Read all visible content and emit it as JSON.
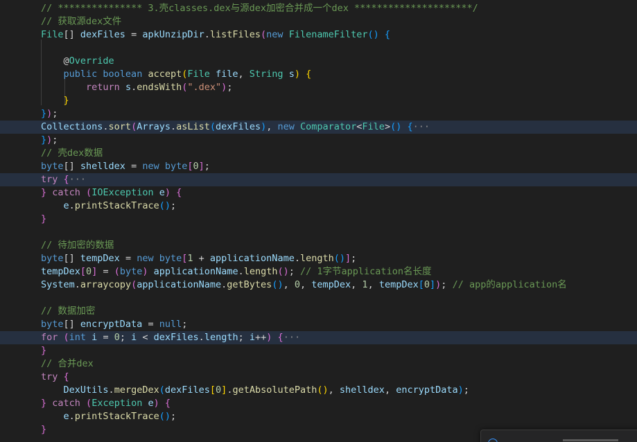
{
  "editor": {
    "lines": [
      {
        "highlight": false,
        "tokens": [
          {
            "t": "// *************** 3.壳classes.dex与源dex加密合并成一个dex *********************/",
            "c": "comment"
          }
        ]
      },
      {
        "highlight": false,
        "tokens": [
          {
            "t": "// 获取源dex文件",
            "c": "comment"
          }
        ]
      },
      {
        "highlight": false,
        "tokens": [
          {
            "t": "File",
            "c": "type"
          },
          {
            "t": "[] ",
            "c": "punc"
          },
          {
            "t": "dexFiles",
            "c": "var"
          },
          {
            "t": " = ",
            "c": "punc"
          },
          {
            "t": "apkUnzipDir",
            "c": "var"
          },
          {
            "t": ".",
            "c": "punc"
          },
          {
            "t": "listFiles",
            "c": "fn"
          },
          {
            "t": "(",
            "c": "b2"
          },
          {
            "t": "new ",
            "c": "kw"
          },
          {
            "t": "FilenameFilter",
            "c": "type"
          },
          {
            "t": "()",
            "c": "b3"
          },
          {
            "t": " ",
            "c": "punc"
          },
          {
            "t": "{",
            "c": "b3"
          }
        ]
      },
      {
        "highlight": false,
        "tokens": []
      },
      {
        "highlight": false,
        "tokens": [
          {
            "t": "    ",
            "c": "punc"
          },
          {
            "t": "@",
            "c": "punc"
          },
          {
            "t": "Override",
            "c": "type"
          }
        ]
      },
      {
        "highlight": false,
        "tokens": [
          {
            "t": "    ",
            "c": "punc"
          },
          {
            "t": "public ",
            "c": "kw"
          },
          {
            "t": "boolean ",
            "c": "kw"
          },
          {
            "t": "accept",
            "c": "fn"
          },
          {
            "t": "(",
            "c": "b1"
          },
          {
            "t": "File ",
            "c": "type"
          },
          {
            "t": "file",
            "c": "var"
          },
          {
            "t": ", ",
            "c": "punc"
          },
          {
            "t": "String ",
            "c": "type"
          },
          {
            "t": "s",
            "c": "var"
          },
          {
            "t": ")",
            "c": "b1"
          },
          {
            "t": " ",
            "c": "punc"
          },
          {
            "t": "{",
            "c": "b1"
          }
        ]
      },
      {
        "highlight": false,
        "tokens": [
          {
            "t": "        ",
            "c": "punc"
          },
          {
            "t": "return ",
            "c": "ctrl"
          },
          {
            "t": "s",
            "c": "var"
          },
          {
            "t": ".",
            "c": "punc"
          },
          {
            "t": "endsWith",
            "c": "fn"
          },
          {
            "t": "(",
            "c": "b2"
          },
          {
            "t": "\".dex\"",
            "c": "str"
          },
          {
            "t": ")",
            "c": "b2"
          },
          {
            "t": ";",
            "c": "punc"
          }
        ]
      },
      {
        "highlight": false,
        "tokens": [
          {
            "t": "    ",
            "c": "punc"
          },
          {
            "t": "}",
            "c": "b1"
          }
        ]
      },
      {
        "highlight": false,
        "tokens": [
          {
            "t": "}",
            "c": "b3"
          },
          {
            "t": ")",
            "c": "b2"
          },
          {
            "t": ";",
            "c": "punc"
          }
        ]
      },
      {
        "highlight": true,
        "tokens": [
          {
            "t": "Collections",
            "c": "var"
          },
          {
            "t": ".",
            "c": "punc"
          },
          {
            "t": "sort",
            "c": "fn"
          },
          {
            "t": "(",
            "c": "b2"
          },
          {
            "t": "Arrays",
            "c": "var"
          },
          {
            "t": ".",
            "c": "punc"
          },
          {
            "t": "asList",
            "c": "fn"
          },
          {
            "t": "(",
            "c": "b3"
          },
          {
            "t": "dexFiles",
            "c": "var"
          },
          {
            "t": ")",
            "c": "b3"
          },
          {
            "t": ", ",
            "c": "punc"
          },
          {
            "t": "new ",
            "c": "kw"
          },
          {
            "t": "Comparator",
            "c": "type"
          },
          {
            "t": "<",
            "c": "punc"
          },
          {
            "t": "File",
            "c": "type"
          },
          {
            "t": ">",
            "c": "punc"
          },
          {
            "t": "()",
            "c": "b3"
          },
          {
            "t": " ",
            "c": "punc"
          },
          {
            "t": "{",
            "c": "b3"
          },
          {
            "t": "···",
            "c": "fold"
          }
        ]
      },
      {
        "highlight": false,
        "tokens": [
          {
            "t": "}",
            "c": "b3"
          },
          {
            "t": ")",
            "c": "b2"
          },
          {
            "t": ";",
            "c": "punc"
          }
        ]
      },
      {
        "highlight": false,
        "tokens": [
          {
            "t": "// 壳dex数据",
            "c": "comment"
          }
        ]
      },
      {
        "highlight": false,
        "tokens": [
          {
            "t": "byte",
            "c": "kw"
          },
          {
            "t": "[] ",
            "c": "punc"
          },
          {
            "t": "shelldex",
            "c": "var"
          },
          {
            "t": " = ",
            "c": "punc"
          },
          {
            "t": "new ",
            "c": "kw"
          },
          {
            "t": "byte",
            "c": "kw"
          },
          {
            "t": "[",
            "c": "b2"
          },
          {
            "t": "0",
            "c": "num"
          },
          {
            "t": "]",
            "c": "b2"
          },
          {
            "t": ";",
            "c": "punc"
          }
        ]
      },
      {
        "highlight": true,
        "tokens": [
          {
            "t": "try ",
            "c": "ctrl"
          },
          {
            "t": "{",
            "c": "b2"
          },
          {
            "t": "···",
            "c": "fold"
          }
        ]
      },
      {
        "highlight": false,
        "tokens": [
          {
            "t": "} ",
            "c": "b2"
          },
          {
            "t": "catch ",
            "c": "ctrl"
          },
          {
            "t": "(",
            "c": "b2"
          },
          {
            "t": "IOException ",
            "c": "type"
          },
          {
            "t": "e",
            "c": "var"
          },
          {
            "t": ")",
            "c": "b2"
          },
          {
            "t": " ",
            "c": "punc"
          },
          {
            "t": "{",
            "c": "b2"
          }
        ]
      },
      {
        "highlight": false,
        "tokens": [
          {
            "t": "    ",
            "c": "punc"
          },
          {
            "t": "e",
            "c": "var"
          },
          {
            "t": ".",
            "c": "punc"
          },
          {
            "t": "printStackTrace",
            "c": "fn"
          },
          {
            "t": "()",
            "c": "b3"
          },
          {
            "t": ";",
            "c": "punc"
          }
        ]
      },
      {
        "highlight": false,
        "tokens": [
          {
            "t": "}",
            "c": "b2"
          }
        ]
      },
      {
        "highlight": false,
        "tokens": []
      },
      {
        "highlight": false,
        "tokens": [
          {
            "t": "// 待加密的数据",
            "c": "comment"
          }
        ]
      },
      {
        "highlight": false,
        "tokens": [
          {
            "t": "byte",
            "c": "kw"
          },
          {
            "t": "[] ",
            "c": "punc"
          },
          {
            "t": "tempDex",
            "c": "var"
          },
          {
            "t": " = ",
            "c": "punc"
          },
          {
            "t": "new ",
            "c": "kw"
          },
          {
            "t": "byte",
            "c": "kw"
          },
          {
            "t": "[",
            "c": "b2"
          },
          {
            "t": "1",
            "c": "num"
          },
          {
            "t": " + ",
            "c": "punc"
          },
          {
            "t": "applicationName",
            "c": "var"
          },
          {
            "t": ".",
            "c": "punc"
          },
          {
            "t": "length",
            "c": "fn"
          },
          {
            "t": "()",
            "c": "b3"
          },
          {
            "t": "]",
            "c": "b2"
          },
          {
            "t": ";",
            "c": "punc"
          }
        ]
      },
      {
        "highlight": false,
        "tokens": [
          {
            "t": "tempDex",
            "c": "var"
          },
          {
            "t": "[",
            "c": "b2"
          },
          {
            "t": "0",
            "c": "num"
          },
          {
            "t": "]",
            "c": "b2"
          },
          {
            "t": " = ",
            "c": "punc"
          },
          {
            "t": "(",
            "c": "b2"
          },
          {
            "t": "byte",
            "c": "kw"
          },
          {
            "t": ")",
            "c": "b2"
          },
          {
            "t": " ",
            "c": "punc"
          },
          {
            "t": "applicationName",
            "c": "var"
          },
          {
            "t": ".",
            "c": "punc"
          },
          {
            "t": "length",
            "c": "fn"
          },
          {
            "t": "()",
            "c": "b2"
          },
          {
            "t": "; ",
            "c": "punc"
          },
          {
            "t": "// 1字节application名长度",
            "c": "comment"
          }
        ]
      },
      {
        "highlight": false,
        "tokens": [
          {
            "t": "System",
            "c": "var"
          },
          {
            "t": ".",
            "c": "punc"
          },
          {
            "t": "arraycopy",
            "c": "fn"
          },
          {
            "t": "(",
            "c": "b2"
          },
          {
            "t": "applicationName",
            "c": "var"
          },
          {
            "t": ".",
            "c": "punc"
          },
          {
            "t": "getBytes",
            "c": "fn"
          },
          {
            "t": "()",
            "c": "b3"
          },
          {
            "t": ", ",
            "c": "punc"
          },
          {
            "t": "0",
            "c": "num"
          },
          {
            "t": ", ",
            "c": "punc"
          },
          {
            "t": "tempDex",
            "c": "var"
          },
          {
            "t": ", ",
            "c": "punc"
          },
          {
            "t": "1",
            "c": "num"
          },
          {
            "t": ", ",
            "c": "punc"
          },
          {
            "t": "tempDex",
            "c": "var"
          },
          {
            "t": "[",
            "c": "b3"
          },
          {
            "t": "0",
            "c": "num"
          },
          {
            "t": "]",
            "c": "b3"
          },
          {
            "t": ")",
            "c": "b2"
          },
          {
            "t": "; ",
            "c": "punc"
          },
          {
            "t": "// app的application名",
            "c": "comment"
          }
        ]
      },
      {
        "highlight": false,
        "tokens": []
      },
      {
        "highlight": false,
        "tokens": [
          {
            "t": "// 数据加密",
            "c": "comment"
          }
        ]
      },
      {
        "highlight": false,
        "tokens": [
          {
            "t": "byte",
            "c": "kw"
          },
          {
            "t": "[] ",
            "c": "punc"
          },
          {
            "t": "encryptData",
            "c": "var"
          },
          {
            "t": " = ",
            "c": "punc"
          },
          {
            "t": "null",
            "c": "kw"
          },
          {
            "t": ";",
            "c": "punc"
          }
        ]
      },
      {
        "highlight": true,
        "tokens": [
          {
            "t": "for ",
            "c": "ctrl"
          },
          {
            "t": "(",
            "c": "b2"
          },
          {
            "t": "int ",
            "c": "kw"
          },
          {
            "t": "i",
            "c": "var"
          },
          {
            "t": " = ",
            "c": "punc"
          },
          {
            "t": "0",
            "c": "num"
          },
          {
            "t": "; ",
            "c": "punc"
          },
          {
            "t": "i",
            "c": "var"
          },
          {
            "t": " < ",
            "c": "punc"
          },
          {
            "t": "dexFiles",
            "c": "var"
          },
          {
            "t": ".",
            "c": "punc"
          },
          {
            "t": "length",
            "c": "var"
          },
          {
            "t": "; ",
            "c": "punc"
          },
          {
            "t": "i",
            "c": "var"
          },
          {
            "t": "++",
            "c": "punc"
          },
          {
            "t": ")",
            "c": "b2"
          },
          {
            "t": " ",
            "c": "punc"
          },
          {
            "t": "{",
            "c": "b2"
          },
          {
            "t": "···",
            "c": "fold"
          }
        ]
      },
      {
        "highlight": false,
        "tokens": [
          {
            "t": "}",
            "c": "b2"
          }
        ]
      },
      {
        "highlight": false,
        "tokens": [
          {
            "t": "// 合并dex",
            "c": "comment"
          }
        ]
      },
      {
        "highlight": false,
        "tokens": [
          {
            "t": "try ",
            "c": "ctrl"
          },
          {
            "t": "{",
            "c": "b2"
          }
        ]
      },
      {
        "highlight": false,
        "tokens": [
          {
            "t": "    ",
            "c": "punc"
          },
          {
            "t": "DexUtils",
            "c": "var"
          },
          {
            "t": ".",
            "c": "punc"
          },
          {
            "t": "mergeDex",
            "c": "fn"
          },
          {
            "t": "(",
            "c": "b3"
          },
          {
            "t": "dexFiles",
            "c": "var"
          },
          {
            "t": "[",
            "c": "b1"
          },
          {
            "t": "0",
            "c": "num"
          },
          {
            "t": "]",
            "c": "b1"
          },
          {
            "t": ".",
            "c": "punc"
          },
          {
            "t": "getAbsolutePath",
            "c": "fn"
          },
          {
            "t": "()",
            "c": "b1"
          },
          {
            "t": ", ",
            "c": "punc"
          },
          {
            "t": "shelldex",
            "c": "var"
          },
          {
            "t": ", ",
            "c": "punc"
          },
          {
            "t": "encryptData",
            "c": "var"
          },
          {
            "t": ")",
            "c": "b3"
          },
          {
            "t": ";",
            "c": "punc"
          }
        ]
      },
      {
        "highlight": false,
        "tokens": [
          {
            "t": "} ",
            "c": "b2"
          },
          {
            "t": "catch ",
            "c": "ctrl"
          },
          {
            "t": "(",
            "c": "b2"
          },
          {
            "t": "Exception ",
            "c": "type"
          },
          {
            "t": "e",
            "c": "var"
          },
          {
            "t": ")",
            "c": "b2"
          },
          {
            "t": " ",
            "c": "punc"
          },
          {
            "t": "{",
            "c": "b2"
          }
        ]
      },
      {
        "highlight": false,
        "tokens": [
          {
            "t": "    ",
            "c": "punc"
          },
          {
            "t": "e",
            "c": "var"
          },
          {
            "t": ".",
            "c": "punc"
          },
          {
            "t": "printStackTrace",
            "c": "fn"
          },
          {
            "t": "()",
            "c": "b3"
          },
          {
            "t": ";",
            "c": "punc"
          }
        ]
      },
      {
        "highlight": false,
        "tokens": [
          {
            "t": "}",
            "c": "b2"
          }
        ]
      }
    ]
  },
  "notification": {
    "icon": "info-icon"
  },
  "colors": {
    "background": "#1f1f1f",
    "highlight_line": "#263040",
    "comment": "#6a9955",
    "keyword": "#569cd6",
    "control": "#c586c0",
    "type": "#4ec9b0",
    "variable": "#9cdcfe",
    "function": "#dcdcaa",
    "string": "#ce9178",
    "number": "#b5cea8"
  }
}
